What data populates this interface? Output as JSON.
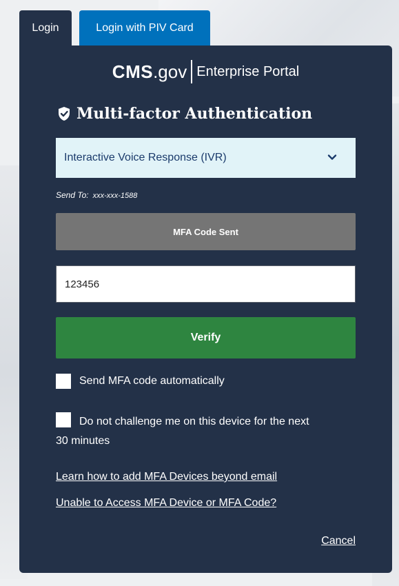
{
  "tabs": {
    "login": "Login",
    "piv": "Login with PIV Card"
  },
  "logo": {
    "cms": "CMS",
    "gov": ".gov",
    "enterprise": "Enterprise Portal"
  },
  "heading": "Multi-factor Authentication",
  "mfa_select": {
    "selected": "Interactive Voice Response (IVR)"
  },
  "send_to": {
    "label": "Send To:",
    "value": "xxx-xxx-1588"
  },
  "mfa_sent_button": "MFA Code Sent",
  "code_input": {
    "value": "123456"
  },
  "verify_button": "Verify",
  "checkboxes": {
    "auto_send": "Send MFA code automatically",
    "no_challenge_line1": "Do not challenge me on this device for the next",
    "no_challenge_line2": "30 minutes"
  },
  "links": {
    "add_devices": "Learn how to add MFA Devices beyond email",
    "unable_access": "Unable to Access MFA Device or MFA Code?"
  },
  "cancel": "Cancel",
  "colors": {
    "panel": "#233148",
    "piv_tab": "#0071bc",
    "select_bg": "#e1f3f8",
    "sent_button": "#757575",
    "verify_button": "#2e8540"
  },
  "icons": {
    "heading": "shield-check-icon",
    "select": "chevron-down-icon"
  }
}
